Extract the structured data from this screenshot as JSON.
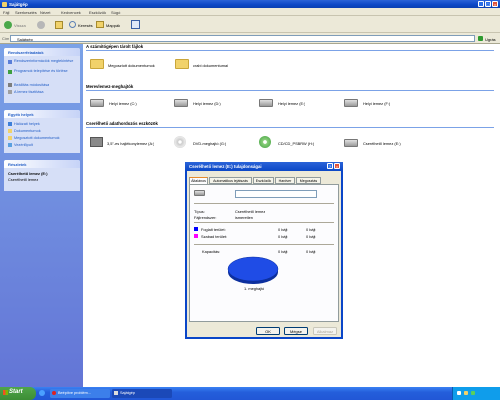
{
  "window": {
    "title": "Sajátgép"
  },
  "menubar": {
    "items": [
      "Fájl",
      "Szerkesztés",
      "Nézet",
      "Kedvencek",
      "Eszközök",
      "Súgó"
    ]
  },
  "toolbar": {
    "back": "Vissza",
    "search": "Keresés",
    "folders": "Mappák"
  },
  "address": {
    "label": "Cím",
    "value": "Sajátgép",
    "go": "Ugrás"
  },
  "left_pane": {
    "system_tasks": {
      "title": "Rendszerfeladatok",
      "items": [
        "Rendszerinformációk megtekintése",
        "Programok telepítése és törlése",
        "Beállítás módosítása",
        "A lemez tisztítása"
      ]
    },
    "other_places": {
      "title": "Egyéb helyek",
      "items": [
        "Hálózati helyek",
        "Dokumentumok",
        "Megosztott dokumentumok",
        "Vezérlőpult"
      ]
    },
    "details": {
      "title": "Részletek",
      "name": "Cserélhető lemez (E:)",
      "type": "Cserélhető lemez"
    }
  },
  "sections": [
    {
      "title": "A számítógépen tárolt fájlok",
      "items": [
        {
          "label": "Megosztott dokumentumok",
          "icon": "folder-icon"
        },
        {
          "label": "crabi dokumentumai",
          "icon": "folder-icon"
        }
      ]
    },
    {
      "title": "Merevlemez-meghajtók",
      "items": [
        {
          "label": "Helyi lemez (C:)",
          "icon": "hard-drive-icon"
        },
        {
          "label": "Helyi lemez (D:)",
          "icon": "hard-drive-icon"
        },
        {
          "label": "Helyi lemez (E:)",
          "icon": "hard-drive-icon"
        },
        {
          "label": "Helyi lemez (F:)",
          "icon": "hard-drive-icon"
        }
      ]
    },
    {
      "title": "Cserélhető adathordozós eszközök",
      "items": [
        {
          "label": "3,5\"-es hajlékonylemez (A:)",
          "icon": "floppy-icon"
        },
        {
          "label": "DVD-meghajtó (G:)",
          "icon": "dvd-icon"
        },
        {
          "label": "CD/CD_PSBRW (H:)",
          "icon": "cd-icon"
        },
        {
          "label": "Cserélhető lemez (E:)",
          "icon": "removable-drive-icon"
        }
      ]
    }
  ],
  "dialog": {
    "title": "Cserélhető lemez (E:) tulajdonságai",
    "tabs": [
      "Általános",
      "Automatikus lejátszás",
      "Eszközök",
      "Hardver",
      "Megosztás"
    ],
    "label_value": "",
    "type_label": "Típus:",
    "type_value": "Cserélhető lemez",
    "fs_label": "Fájlrendszer:",
    "fs_value": "ismeretlen",
    "used_label": "Foglalt terület:",
    "used_bytes": "0 bájt",
    "used_size": "0 bájt",
    "free_label": "Szabad terület:",
    "free_bytes": "0 bájt",
    "free_size": "0 bájt",
    "capacity_label": "Kapacitás:",
    "capacity_bytes": "0 bájt",
    "capacity_size": "0 bájt",
    "drive_caption": "1. meghajtó",
    "buttons": {
      "ok": "OK",
      "cancel": "Mégse",
      "apply": "Alkalmaz"
    },
    "used_color": "#0000ff",
    "free_color": "#ff00ff",
    "pie_color": "#1f4ce6"
  },
  "taskbar": {
    "start": "Start",
    "tasks": [
      "Beépítve problém...",
      "Sajátgép"
    ]
  }
}
